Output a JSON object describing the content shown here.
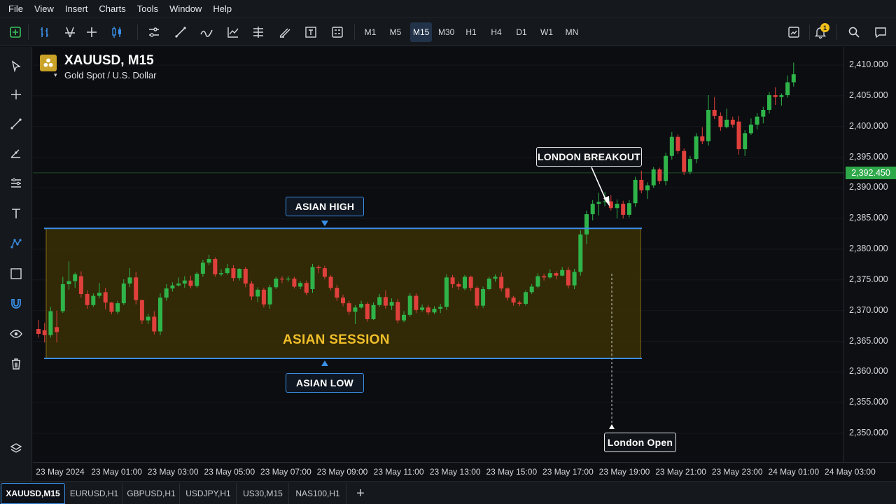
{
  "menu": [
    "File",
    "View",
    "Insert",
    "Charts",
    "Tools",
    "Window",
    "Help"
  ],
  "toolbar": {
    "tools_left": [
      "new-chart-icon",
      "bar-chart-icon",
      "candles-icon",
      "crosshair-icon",
      "line-chart-icon",
      "indicators-icon",
      "trendline-icon",
      "zigzag-icon",
      "oscillator-icon",
      "fibonacci-icon",
      "channel-icon",
      "text-box-icon",
      "templates-icon"
    ],
    "timeframes": [
      "M1",
      "M5",
      "M15",
      "M30",
      "H1",
      "H4",
      "D1",
      "W1",
      "MN"
    ],
    "active_timeframe": "M15",
    "tools_right": [
      "chart-window-icon",
      "bell-icon",
      "search-icon",
      "chat-icon"
    ],
    "notification_count": "1"
  },
  "left_tools": [
    "cursor-icon",
    "crosshair-icon",
    "line-icon",
    "ray-icon",
    "channel-icon",
    "text-icon",
    "pattern-icon",
    "rectangle-icon",
    "magnet-icon",
    "eye-icon",
    "trash-icon",
    "layers-icon"
  ],
  "symbol": {
    "title": "XAUUSD, M15",
    "subtitle": "Gold Spot / U.S. Dollar"
  },
  "annotations": {
    "asian_high": "ASIAN HIGH",
    "asian_low": "ASIAN LOW",
    "asian_session": "ASIAN SESSION",
    "london_breakout": "LONDON BREAKOUT",
    "london_open": "London Open"
  },
  "current_price": "2,392.450",
  "colors": {
    "bull": "#2fb44a",
    "bear": "#e0403c",
    "level_line": "#3a8fe6",
    "session_fill": "#3a2f05",
    "session_text": "#f0bf2a",
    "current_price_bg": "#2fa84a"
  },
  "tabs": [
    "XAUUSD,M15",
    "EURUSD,H1",
    "GBPUSD,H1",
    "USDJPY,H1",
    "US30,M15",
    "NAS100,H1"
  ],
  "chart_data": {
    "type": "candlestick",
    "symbol": "XAUUSD",
    "timeframe": "M15",
    "y_ticks": [
      2410,
      2405,
      2400,
      2395,
      2390,
      2385,
      2380,
      2375,
      2370,
      2365,
      2360,
      2355,
      2350
    ],
    "y_tick_labels": [
      "2,410.000",
      "2,405.000",
      "2,400.000",
      "2,395.000",
      "2,390.000",
      "2,385.000",
      "2,380.000",
      "2,375.000",
      "2,370.000",
      "2,365.000",
      "2,360.000",
      "2,355.000",
      "2,350.000"
    ],
    "x_tick_labels": [
      "23 May 2024",
      "23 May 01:00",
      "23 May 03:00",
      "23 May 05:00",
      "23 May 07:00",
      "23 May 09:00",
      "23 May 11:00",
      "23 May 13:00",
      "23 May 15:00",
      "23 May 17:00",
      "23 May 19:00",
      "23 May 21:00",
      "23 May 23:00",
      "24 May 01:00",
      "24 May 03:00"
    ],
    "ylim": [
      2345,
      2413
    ],
    "asian_high": 2383.4,
    "asian_low": 2362.2,
    "current_price": 2392.45,
    "ohlc": [
      [
        2367.0,
        2368.5,
        2365.6,
        2366.2
      ],
      [
        2366.8,
        2368.0,
        2364.8,
        2366.0
      ],
      [
        2366.0,
        2370.6,
        2365.6,
        2369.9
      ],
      [
        2367.3,
        2370.0,
        2364.8,
        2366.5
      ],
      [
        2369.9,
        2375.5,
        2369.6,
        2374.3
      ],
      [
        2374.3,
        2378.0,
        2373.4,
        2374.8
      ],
      [
        2374.8,
        2376.2,
        2373.7,
        2375.9
      ],
      [
        2375.6,
        2376.4,
        2372.1,
        2372.7
      ],
      [
        2372.7,
        2373.3,
        2370.3,
        2370.9
      ],
      [
        2370.9,
        2372.8,
        2370.6,
        2372.4
      ],
      [
        2372.4,
        2374.5,
        2372.0,
        2372.9
      ],
      [
        2373.0,
        2373.7,
        2370.2,
        2371.3
      ],
      [
        2371.3,
        2371.4,
        2369.4,
        2369.8
      ],
      [
        2369.8,
        2371.6,
        2369.4,
        2371.2
      ],
      [
        2371.2,
        2375.1,
        2370.9,
        2374.4
      ],
      [
        2374.4,
        2376.9,
        2373.8,
        2375.4
      ],
      [
        2375.4,
        2376.3,
        2371.0,
        2371.7
      ],
      [
        2371.7,
        2371.8,
        2367.8,
        2368.4
      ],
      [
        2368.4,
        2369.5,
        2367.8,
        2369.0
      ],
      [
        2369.0,
        2369.9,
        2366.1,
        2366.6
      ],
      [
        2366.6,
        2372.8,
        2366.0,
        2372.1
      ],
      [
        2372.1,
        2374.3,
        2371.6,
        2373.6
      ],
      [
        2373.6,
        2374.6,
        2373.1,
        2374.1
      ],
      [
        2374.1,
        2375.4,
        2373.9,
        2374.4
      ],
      [
        2374.4,
        2375.6,
        2373.7,
        2374.9
      ],
      [
        2374.9,
        2375.7,
        2373.6,
        2374.0
      ],
      [
        2374.0,
        2376.3,
        2373.7,
        2376.0
      ],
      [
        2376.0,
        2378.3,
        2375.5,
        2377.8
      ],
      [
        2377.8,
        2379.1,
        2377.4,
        2378.4
      ],
      [
        2378.4,
        2378.7,
        2375.5,
        2375.9
      ],
      [
        2375.9,
        2376.7,
        2375.6,
        2376.1
      ],
      [
        2376.1,
        2377.6,
        2375.8,
        2376.9
      ],
      [
        2376.9,
        2377.4,
        2374.8,
        2375.3
      ],
      [
        2375.3,
        2376.9,
        2374.9,
        2376.8
      ],
      [
        2376.8,
        2377.1,
        2373.8,
        2374.4
      ],
      [
        2374.4,
        2374.8,
        2371.7,
        2372.3
      ],
      [
        2372.3,
        2373.8,
        2371.4,
        2373.4
      ],
      [
        2373.4,
        2373.7,
        2370.5,
        2371.0
      ],
      [
        2371.0,
        2374.2,
        2370.3,
        2373.8
      ],
      [
        2373.8,
        2375.5,
        2373.5,
        2375.2
      ],
      [
        2375.2,
        2375.6,
        2374.5,
        2375.1
      ],
      [
        2375.1,
        2375.6,
        2374.7,
        2375.2
      ],
      [
        2375.2,
        2375.5,
        2373.6,
        2373.9
      ],
      [
        2373.9,
        2374.8,
        2373.5,
        2374.5
      ],
      [
        2374.5,
        2374.9,
        2372.5,
        2372.9
      ],
      [
        2373.5,
        2377.6,
        2372.9,
        2377.1
      ],
      [
        2377.1,
        2377.4,
        2376.1,
        2376.9
      ],
      [
        2376.9,
        2377.3,
        2375.1,
        2375.5
      ],
      [
        2375.5,
        2375.8,
        2373.3,
        2373.7
      ],
      [
        2373.7,
        2374.2,
        2371.6,
        2372.1
      ],
      [
        2372.1,
        2372.6,
        2370.7,
        2371.2
      ],
      [
        2371.2,
        2371.6,
        2369.3,
        2369.8
      ],
      [
        2369.8,
        2370.9,
        2367.8,
        2370.5
      ],
      [
        2370.5,
        2371.6,
        2370.3,
        2371.1
      ],
      [
        2371.1,
        2371.4,
        2368.2,
        2368.6
      ],
      [
        2368.6,
        2371.3,
        2368.5,
        2370.9
      ],
      [
        2370.9,
        2372.7,
        2370.6,
        2372.2
      ],
      [
        2372.2,
        2373.3,
        2370.3,
        2370.8
      ],
      [
        2370.8,
        2372.0,
        2370.1,
        2371.4
      ],
      [
        2371.4,
        2371.9,
        2367.9,
        2368.4
      ],
      [
        2368.4,
        2369.9,
        2368.1,
        2369.3
      ],
      [
        2369.3,
        2372.8,
        2369.0,
        2372.4
      ],
      [
        2372.4,
        2372.8,
        2369.6,
        2370.1
      ],
      [
        2370.1,
        2371.0,
        2369.8,
        2370.5
      ],
      [
        2370.5,
        2370.9,
        2369.3,
        2369.7
      ],
      [
        2369.7,
        2370.7,
        2369.4,
        2370.3
      ],
      [
        2370.3,
        2371.1,
        2369.6,
        2370.6
      ],
      [
        2370.6,
        2375.9,
        2370.1,
        2375.4
      ],
      [
        2375.4,
        2375.8,
        2373.7,
        2374.3
      ],
      [
        2374.3,
        2374.7,
        2373.4,
        2373.9
      ],
      [
        2373.6,
        2375.8,
        2373.3,
        2375.5
      ],
      [
        2375.5,
        2375.7,
        2373.2,
        2373.7
      ],
      [
        2373.7,
        2374.0,
        2370.3,
        2370.8
      ],
      [
        2370.8,
        2373.9,
        2370.4,
        2373.5
      ],
      [
        2373.5,
        2375.5,
        2373.3,
        2375.2
      ],
      [
        2375.2,
        2375.9,
        2374.7,
        2375.5
      ],
      [
        2375.5,
        2376.2,
        2373.1,
        2373.6
      ],
      [
        2373.6,
        2373.8,
        2371.6,
        2372.1
      ],
      [
        2372.1,
        2372.4,
        2370.8,
        2371.3
      ],
      [
        2371.3,
        2371.6,
        2370.7,
        2371.1
      ],
      [
        2371.1,
        2373.3,
        2370.8,
        2373.0
      ],
      [
        2373.0,
        2374.3,
        2372.7,
        2373.9
      ],
      [
        2373.9,
        2376.1,
        2373.6,
        2375.6
      ],
      [
        2375.6,
        2376.0,
        2374.9,
        2375.4
      ],
      [
        2375.4,
        2376.7,
        2375.2,
        2376.1
      ],
      [
        2376.1,
        2376.4,
        2375.1,
        2375.7
      ],
      [
        2375.7,
        2377.1,
        2375.6,
        2376.6
      ],
      [
        2376.6,
        2377.1,
        2373.6,
        2374.1
      ],
      [
        2374.1,
        2376.8,
        2373.5,
        2376.3
      ],
      [
        2376.3,
        2383.1,
        2375.7,
        2382.4
      ],
      [
        2382.4,
        2386.3,
        2380.8,
        2385.7
      ],
      [
        2385.7,
        2388.0,
        2384.7,
        2387.4
      ],
      [
        2387.4,
        2389.2,
        2385.5,
        2387.7
      ],
      [
        2387.7,
        2389.3,
        2387.0,
        2387.8
      ],
      [
        2387.8,
        2388.8,
        2386.3,
        2386.7
      ],
      [
        2386.7,
        2388.1,
        2385.0,
        2387.4
      ],
      [
        2387.4,
        2387.9,
        2385.0,
        2385.6
      ],
      [
        2385.6,
        2388.0,
        2385.2,
        2387.5
      ],
      [
        2387.5,
        2391.8,
        2386.9,
        2391.3
      ],
      [
        2391.3,
        2392.8,
        2389.1,
        2389.6
      ],
      [
        2389.6,
        2390.9,
        2388.2,
        2390.4
      ],
      [
        2390.4,
        2393.4,
        2390.0,
        2393.0
      ],
      [
        2393.0,
        2393.3,
        2390.6,
        2391.1
      ],
      [
        2391.1,
        2395.7,
        2390.4,
        2395.2
      ],
      [
        2395.2,
        2399.1,
        2394.6,
        2398.3
      ],
      [
        2398.3,
        2398.7,
        2395.5,
        2396.0
      ],
      [
        2396.0,
        2396.4,
        2392.1,
        2392.6
      ],
      [
        2392.6,
        2395.2,
        2392.2,
        2394.7
      ],
      [
        2394.7,
        2398.9,
        2394.0,
        2398.4
      ],
      [
        2398.4,
        2399.9,
        2397.1,
        2397.6
      ],
      [
        2397.6,
        2405.1,
        2396.9,
        2402.7
      ],
      [
        2402.7,
        2404.8,
        2401.2,
        2401.7
      ],
      [
        2401.7,
        2402.3,
        2399.3,
        2399.9
      ],
      [
        2399.9,
        2402.9,
        2399.7,
        2401.1
      ],
      [
        2401.1,
        2401.6,
        2399.8,
        2400.3
      ],
      [
        2400.8,
        2401.7,
        2395.4,
        2396.3
      ],
      [
        2396.3,
        2399.4,
        2395.2,
        2398.9
      ],
      [
        2398.9,
        2401.3,
        2398.6,
        2400.3
      ],
      [
        2400.3,
        2402.2,
        2399.5,
        2401.6
      ],
      [
        2401.6,
        2403.2,
        2400.5,
        2402.7
      ],
      [
        2402.7,
        2405.6,
        2402.1,
        2405.1
      ],
      [
        2405.1,
        2406.4,
        2403.5,
        2404.8
      ],
      [
        2404.8,
        2405.4,
        2403.4,
        2405.1
      ],
      [
        2405.1,
        2408.3,
        2404.7,
        2407.2
      ],
      [
        2407.2,
        2410.4,
        2406.5,
        2408.5
      ]
    ]
  }
}
